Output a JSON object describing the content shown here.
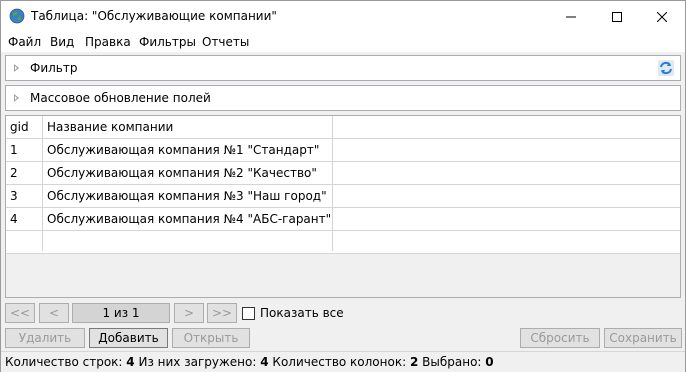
{
  "window": {
    "title": "Таблица: \"Обслуживающие компании\"",
    "icon": "globe-icon",
    "controls": [
      "minimize-icon",
      "maximize-icon",
      "close-icon"
    ]
  },
  "menu": [
    "Файл",
    "Вид",
    "Правка",
    "Фильтры",
    "Отчеты"
  ],
  "filter_panel": {
    "title": "Фильтр",
    "icon": "refresh-icon"
  },
  "mass_update_panel": {
    "title": "Массовое обновление полей"
  },
  "table": {
    "columns": [
      "gid",
      "Название компании"
    ],
    "rows": [
      [
        "1",
        "Обслуживающая компания №1 \"Стандарт\""
      ],
      [
        "2",
        "Обслуживающая компания №2 \"Качество\""
      ],
      [
        "3",
        "Обслуживающая компания №3 \"Наш город\""
      ],
      [
        "4",
        "Обслуживающая компания №4 \"АБС-гарант\""
      ]
    ]
  },
  "pager": {
    "first": "<<",
    "prev": "<",
    "page": "1 из 1",
    "next": ">",
    "last": ">>",
    "show_all_label": "Показать все",
    "show_all_checked": false
  },
  "actions": {
    "delete": "Удалить",
    "add": "Добавить",
    "open": "Открыть",
    "reset": "Сбросить",
    "save": "Сохранить"
  },
  "status": {
    "rows_label": "Количество строк:",
    "rows_value": "4",
    "loaded_label": "Из них загружено:",
    "loaded_value": "4",
    "cols_label": "Количество колонок:",
    "cols_value": "2",
    "selected_label": "Выбрано:",
    "selected_value": "0"
  }
}
